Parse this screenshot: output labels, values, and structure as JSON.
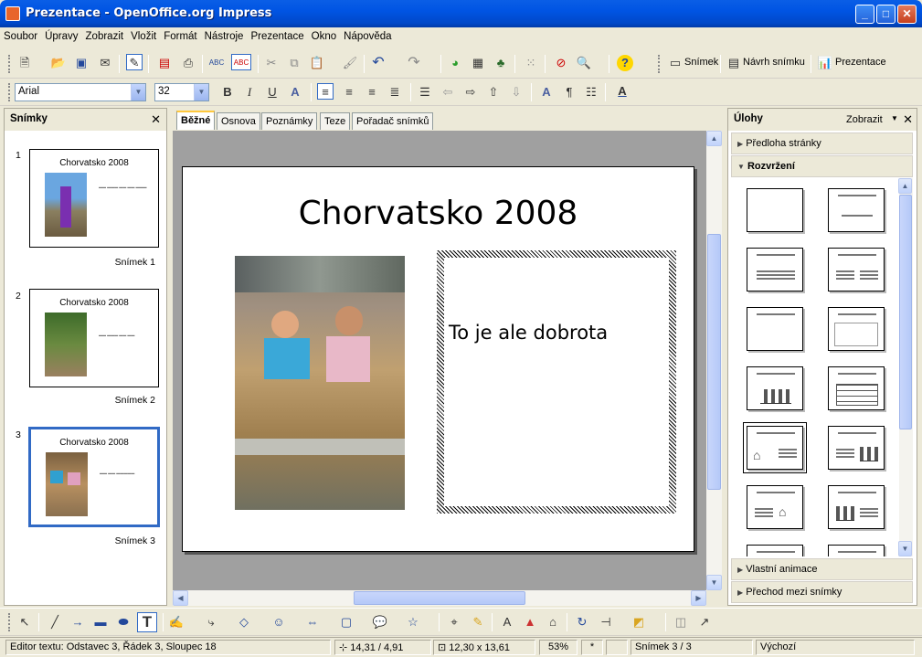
{
  "window": {
    "title": "Prezentace - OpenOffice.org Impress"
  },
  "menu": [
    "Soubor",
    "Úpravy",
    "Zobrazit",
    "Vložit",
    "Formát",
    "Nástroje",
    "Prezentace",
    "Okno",
    "Nápověda"
  ],
  "toolbar": {
    "slide_label": "Snímek",
    "design_label": "Návrh snímku",
    "presentation_label": "Prezentace"
  },
  "format": {
    "font": "Arial",
    "size": "32"
  },
  "slides_panel": {
    "title": "Snímky",
    "slides": [
      {
        "num": "1",
        "title": "Chorvatsko 2008",
        "label": "Snímek 1"
      },
      {
        "num": "2",
        "title": "Chorvatsko 2008",
        "label": "Snímek 2"
      },
      {
        "num": "3",
        "title": "Chorvatsko 2008",
        "label": "Snímek 3"
      }
    ]
  },
  "tabs": [
    "Běžné",
    "Osnova",
    "Poznámky",
    "Teze",
    "Pořadač snímků"
  ],
  "slide": {
    "title": "Chorvatsko 2008",
    "body": "To je ale dobrota"
  },
  "tasks": {
    "title": "Úlohy",
    "view_label": "Zobrazit",
    "sections": {
      "master": "Předloha stránky",
      "layouts": "Rozvržení",
      "animation": "Vlastní animace",
      "transition": "Přechod mezi snímky"
    }
  },
  "status": {
    "mode": "Editor textu: Odstavec 3, Řádek 3, Sloupec 18",
    "position": "14,31 / 4,91",
    "size": "12,30 x 13,61",
    "zoom": "53%",
    "modified": "*",
    "slide": "Snímek 3 / 3",
    "master": "Výchozí"
  },
  "colors": {
    "accent": "#0054e3",
    "selected": "#316ac5"
  }
}
